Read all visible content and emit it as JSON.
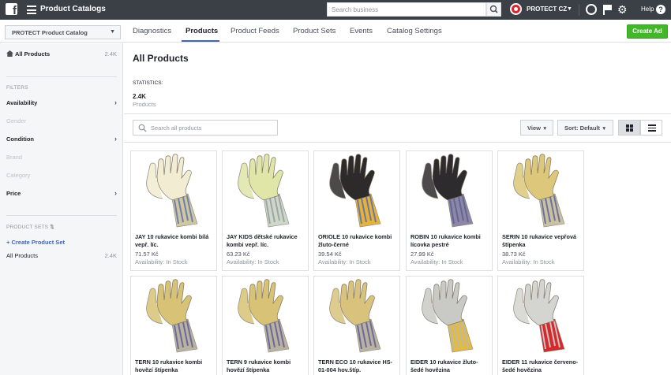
{
  "topbar": {
    "app_title": "Product Catalogs",
    "search_placeholder": "Search business",
    "account_name": "PROTECT CZ",
    "help_label": "Help"
  },
  "subbar": {
    "catalog_selector": "PROTECT Product Catalog",
    "tabs": [
      {
        "label": "Diagnostics",
        "active": false
      },
      {
        "label": "Products",
        "active": true
      },
      {
        "label": "Product Feeds",
        "active": false
      },
      {
        "label": "Product Sets",
        "active": false
      },
      {
        "label": "Events",
        "active": false
      },
      {
        "label": "Catalog Settings",
        "active": false
      }
    ],
    "create_ad_label": "Create Ad"
  },
  "sidebar": {
    "all_products_label": "All Products",
    "all_products_count": "2.4K",
    "filters_heading": "FILTERS",
    "filters": [
      {
        "label": "Availability",
        "enabled": true
      },
      {
        "label": "Gender",
        "enabled": false
      },
      {
        "label": "Condition",
        "enabled": true
      },
      {
        "label": "Brand",
        "enabled": false
      },
      {
        "label": "Category",
        "enabled": false
      },
      {
        "label": "Price",
        "enabled": true
      }
    ],
    "product_sets_heading": "PRODUCT SETS",
    "create_set_label": "+ Create Product Set",
    "set_all_products_label": "All Products",
    "set_all_products_count": "2.4K"
  },
  "main": {
    "title": "All Products",
    "statistics_label": "STATISTICS:",
    "statistics_value": "2.4K",
    "statistics_unit": "Products",
    "search_placeholder": "Search all products",
    "view_label": "View",
    "sort_label": "Sort: Default"
  },
  "products": [
    {
      "name": "JAY 10 rukavice kombi bílá vepř. líc.",
      "price": "71.57 Kč",
      "availability": "Availability: In Stock",
      "palm": "#f2ecd2",
      "cuff": "#cfc6a4",
      "stripe": "#6f7fa6"
    },
    {
      "name": "JAY KIDS dětské rukavice kombi vepř. líc.",
      "price": "63.23 Kč",
      "availability": "Availability: In Stock",
      "palm": "#dfe6a8",
      "cuff": "#cfd8c8",
      "stripe": "#9aa6a8"
    },
    {
      "name": "ORIOLE 10 rukavice kombi žluto-černé",
      "price": "39.54 Kč",
      "availability": "Availability: In Stock",
      "palm": "#2c2a2a",
      "cuff": "#e5b33a",
      "stripe": "#6e77a0"
    },
    {
      "name": "ROBIN 10 rukavice kombi lícovka pestré",
      "price": "27.99 Kč",
      "availability": "Availability: In Stock",
      "palm": "#2d2b2d",
      "cuff": "#8d86a8",
      "stripe": "#5f6890"
    },
    {
      "name": "SERIN 10 rukavice vepřová štípenka",
      "price": "38.73 Kč",
      "availability": "Availability: In Stock",
      "palm": "#dcc77a",
      "cuff": "#c9c2a0",
      "stripe": "#6f6fa0"
    },
    {
      "name": "TERN 10 rukavice kombi hovězí štípenka",
      "price": "",
      "availability": "",
      "palm": "#d8c276",
      "cuff": "#b9b2a0",
      "stripe": "#6b6a9b"
    },
    {
      "name": "TERN 9 rukavice kombi hovězí štípenka",
      "price": "",
      "availability": "",
      "palm": "#d8c276",
      "cuff": "#b9b2a0",
      "stripe": "#6b6a9b"
    },
    {
      "name": "TERN ECO 10 rukavice HS-01-004 hov.štíp.",
      "price": "",
      "availability": "",
      "palm": "#d9c37c",
      "cuff": "#b9b2a0",
      "stripe": "#6b6a9b"
    },
    {
      "name": "EIDER 10 rukavice žluto-šedé hovězina",
      "price": "",
      "availability": "",
      "palm": "#c9c9c5",
      "cuff": "#e3bc3f",
      "stripe": "#b8b8b4"
    },
    {
      "name": "EIDER 11 rukavice červeno-šedé hovězina",
      "price": "",
      "availability": "",
      "palm": "#d4d4d0",
      "cuff": "#d9282c",
      "stripe": "#c5c5c1"
    }
  ]
}
